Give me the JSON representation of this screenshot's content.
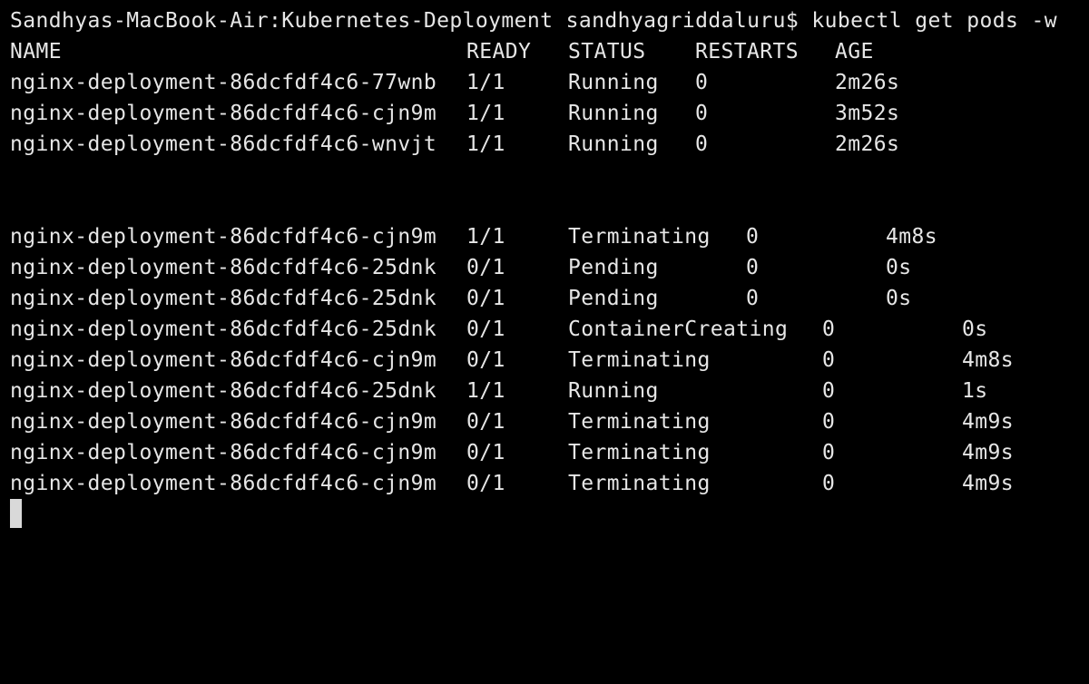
{
  "terminal": {
    "prompt": "Sandhyas-MacBook-Air:Kubernetes-Deployment sandhyagriddaluru$ kubectl get pods -w",
    "headers": {
      "name": "NAME",
      "ready": "READY",
      "status": "STATUS",
      "restarts": "RESTARTS",
      "age": "AGE"
    },
    "rows": [
      {
        "name": "nginx-deployment-86dcfdf4c6-77wnb",
        "ready": "1/1",
        "status": "Running",
        "restarts": "0",
        "age": "2m26s"
      },
      {
        "name": "nginx-deployment-86dcfdf4c6-cjn9m",
        "ready": "1/1",
        "status": "Running",
        "restarts": "0",
        "age": "3m52s"
      },
      {
        "name": "nginx-deployment-86dcfdf4c6-wnvjt",
        "ready": "1/1",
        "status": "Running",
        "restarts": "0",
        "age": "2m26s"
      }
    ],
    "watch_rows": [
      {
        "name": "nginx-deployment-86dcfdf4c6-cjn9m",
        "ready": "1/1",
        "status": "Terminating",
        "restarts": "0",
        "age": "4m8s"
      },
      {
        "name": "nginx-deployment-86dcfdf4c6-25dnk",
        "ready": "0/1",
        "status": "Pending",
        "restarts": "0",
        "age": "0s"
      },
      {
        "name": "nginx-deployment-86dcfdf4c6-25dnk",
        "ready": "0/1",
        "status": "Pending",
        "restarts": "0",
        "age": "0s"
      },
      {
        "name": "nginx-deployment-86dcfdf4c6-25dnk",
        "ready": "0/1",
        "status": "ContainerCreating",
        "restarts": "0",
        "age": "0s"
      },
      {
        "name": "nginx-deployment-86dcfdf4c6-cjn9m",
        "ready": "0/1",
        "status": "Terminating",
        "restarts": "0",
        "age": "4m8s"
      },
      {
        "name": "nginx-deployment-86dcfdf4c6-25dnk",
        "ready": "1/1",
        "status": "Running",
        "restarts": "0",
        "age": "1s"
      },
      {
        "name": "nginx-deployment-86dcfdf4c6-cjn9m",
        "ready": "0/1",
        "status": "Terminating",
        "restarts": "0",
        "age": "4m9s"
      },
      {
        "name": "nginx-deployment-86dcfdf4c6-cjn9m",
        "ready": "0/1",
        "status": "Terminating",
        "restarts": "0",
        "age": "4m9s"
      },
      {
        "name": "nginx-deployment-86dcfdf4c6-cjn9m",
        "ready": "0/1",
        "status": "Terminating",
        "restarts": "0",
        "age": "4m9s"
      }
    ],
    "colors": {
      "background": "#000000",
      "foreground": "#e6e6e6",
      "cursor": "#d9d9d9"
    }
  }
}
